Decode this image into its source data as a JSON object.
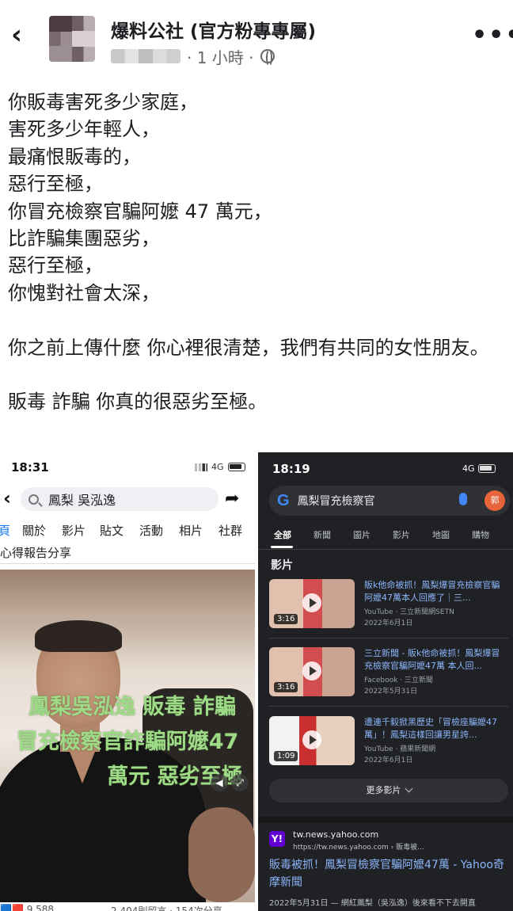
{
  "header": {
    "page_name": "爆料公社 (官方粉專專屬)",
    "time": "· 1 小時 ·",
    "back_icon": "chevron-left-icon",
    "more_icon": "more-dots-icon",
    "privacy_icon": "globe-icon"
  },
  "post": {
    "lines": [
      "你販毒害死多少家庭，",
      "害死多少年輕人，",
      "最痛恨販毒的，",
      "惡行至極，",
      "你冒充檢察官騙阿嬤 47 萬元，",
      "比詐騙集團惡劣，",
      "惡行至極，",
      "你愧對社會太深，"
    ],
    "paragraph2": "你之前上傳什麼 你心裡很清楚，我們有共同的女性朋友。",
    "paragraph3": "販毒 詐騙 你真的很惡劣至極。"
  },
  "left_screenshot": {
    "status_time": "18:31",
    "network": "4G",
    "search_text": "鳳梨 吳泓逸",
    "tabs": [
      "頁",
      "關於",
      "影片",
      "貼文",
      "活動",
      "相片",
      "社群"
    ],
    "subline": "心得報告分享",
    "overlay_lines": [
      "鳳梨吳泓逸 販毒 詐騙",
      "冒充檢察官詐騙阿嬤47",
      "萬元 惡劣至極"
    ],
    "stats_left": "🟦🟥 9,588",
    "stats_right": "2,404則留言 · 154次分享"
  },
  "right_screenshot": {
    "status_time": "18:19",
    "network": "4G",
    "search_text": "鳳梨冒充檢察官",
    "account_initial": "郭",
    "tabs": [
      "全部",
      "新聞",
      "圖片",
      "影片",
      "地圖",
      "購物"
    ],
    "section_title": "影片",
    "videos": [
      {
        "title": "販k他命被抓！鳳梨爆冒充檢察官騙阿嬤47萬本人回應了｜三...",
        "source": "YouTube · 三立新聞網SETN",
        "date": "2022年6月1日",
        "duration": "3:16"
      },
      {
        "title": "三立新聞 - 販k他命被抓！鳳梨爆冒充檢察官騙阿嬤47萬 本人回...",
        "source": "Facebook · 三立新聞",
        "date": "2022年5月31日",
        "duration": "3:16"
      },
      {
        "title": "遭連千毅掀黑歷史「冒檢座騙嬤47萬」！鳳梨這樣回讓男星誇...",
        "source": "YouTube · 蘋果新聞網",
        "date": "2022年6月1日",
        "duration": "1:09"
      }
    ],
    "more_videos": "更多影片",
    "result": {
      "domain": "tw.news.yahoo.com",
      "url": "https://tw.news.yahoo.com › 販毒被...",
      "title": "販毒被抓！鳳梨冒檢察官騙阿嬤47萬 - Yahoo奇摩新聞",
      "snippet": "2022年5月31日 — 網紅鳳梨（吳泓逸）後來看不下去開直"
    }
  }
}
